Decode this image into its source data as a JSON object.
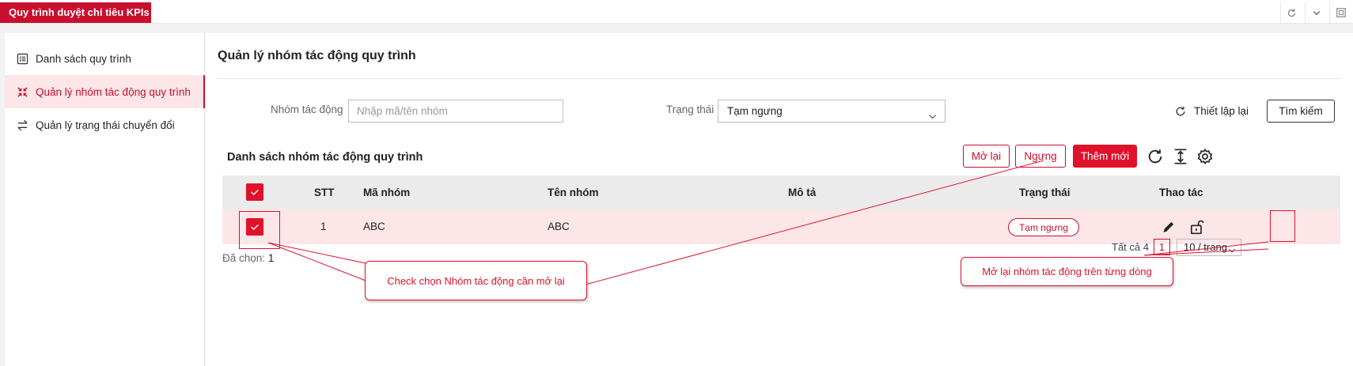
{
  "app": {
    "title": "Quy trình duyệt chỉ tiêu KPIs"
  },
  "window_controls": [
    {
      "name": "refresh-icon"
    },
    {
      "name": "chevron-down-icon"
    },
    {
      "name": "restore-window-icon"
    }
  ],
  "sidebar": {
    "items": [
      {
        "label": "Danh sách quy trình",
        "icon": "list-icon",
        "active": false
      },
      {
        "label": "Quản lý nhóm tác động quy trình",
        "icon": "collapse-icon",
        "active": true
      },
      {
        "label": "Quản lý trạng thái chuyển đổi",
        "icon": "swap-icon",
        "active": false
      }
    ]
  },
  "main": {
    "title": "Quản lý nhóm tác động quy trình",
    "filters": {
      "group_label": "Nhóm tác động",
      "group_placeholder": "Nhập mã/tên nhóm",
      "status_label": "Trạng thái",
      "status_value": "Tạm ngưng",
      "reset_label": "Thiết lập lại",
      "search_label": "Tìm kiếm"
    },
    "list": {
      "title": "Danh sách nhóm tác động quy trình",
      "buttons": {
        "reopen": "Mở lại",
        "stop": "Ngưng",
        "add": "Thêm mới"
      },
      "toolbar_icons": [
        "reload-icon",
        "column-height-icon",
        "settings-icon"
      ]
    },
    "table": {
      "headers": {
        "stt": "STT",
        "code": "Mã nhóm",
        "name": "Tên nhóm",
        "desc": "Mô tả",
        "status": "Trạng thái",
        "actions": "Thao tác"
      },
      "rows": [
        {
          "stt": "1",
          "code": "ABC",
          "name": "ABC",
          "desc": "",
          "status": "Tạm ngưng",
          "checked": true
        }
      ]
    },
    "footer": {
      "selected_label": "Đã chọn:",
      "selected_count": "1",
      "total_label": "Tất cả 4",
      "current_page": "1",
      "page_size": "10 / trang"
    }
  },
  "annotations": {
    "checkbox_callout": "Check chọn Nhóm tác động cần mở lại",
    "row_action_callout": "Mở lại nhóm tác động trên từng dòng"
  },
  "colors": {
    "brand": "#c8102e",
    "primary_button": "#e0112b",
    "selected_row": "#fce6e8",
    "header_bg": "#ebebeb"
  }
}
